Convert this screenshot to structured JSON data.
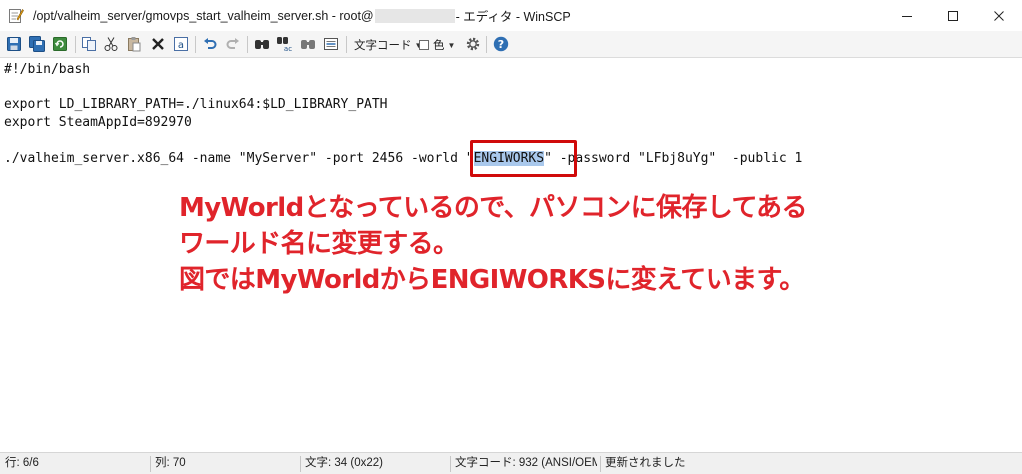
{
  "window": {
    "title_path": "/opt/valheim_server/gmovps_start_valheim_server.sh - root@",
    "title_suffix": "- エディタ - WinSCP"
  },
  "toolbar": {
    "icons": [
      "save-icon",
      "save-all-icon",
      "reload-icon",
      "copy-icon",
      "cut-icon",
      "paste-icon",
      "delete-icon",
      "select-all-icon",
      "undo-icon",
      "redo-icon",
      "find-icon",
      "replace-icon",
      "find-next-icon",
      "goto-line-icon",
      "settings-icon",
      "help-icon"
    ],
    "encoding_label": "文字コード",
    "color_label": "色"
  },
  "editor": {
    "lines": [
      "#!/bin/bash",
      "",
      "export LD_LIBRARY_PATH=./linux64:$LD_LIBRARY_PATH",
      "export SteamAppId=892970",
      "",
      "./valheim_server.x86_64 -name \"MyServer\" -port 2456 -world \"",
      "ENGIWORKS",
      "\" -password \"LFbj8uYg\"  -public 1"
    ]
  },
  "annotation": {
    "line1": "MyWorldとなっているので、パソコンに保存してある",
    "line2": "ワールド名に変更する。",
    "line3": "図ではMyWorldからENGIWORKSに変えています。"
  },
  "status": {
    "line": "行: 6/6",
    "column": "列: 70",
    "char": "文字: 34 (0x22)",
    "encoding": "文字コード: 932  (ANSI/OEM",
    "modified": "更新されました"
  },
  "colors": {
    "accent_red": "#e0242b",
    "selection": "#a9c8ec"
  }
}
